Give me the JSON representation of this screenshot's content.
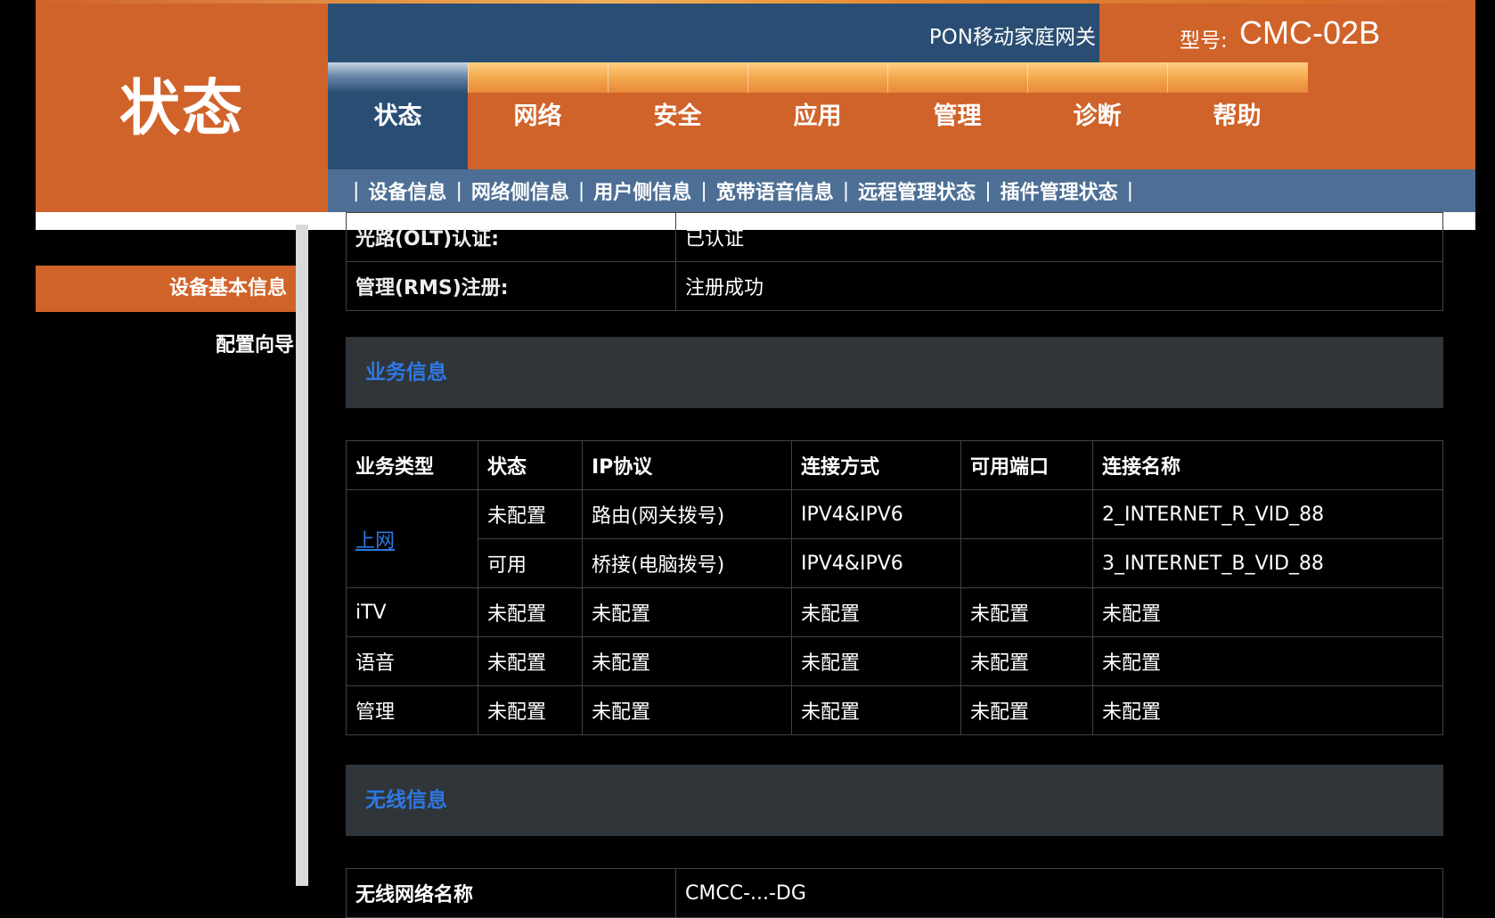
{
  "header": {
    "page_title": "状态",
    "product_name": "PON移动家庭网关",
    "model_label": "型号:",
    "model_value": "CMC-02B",
    "menu": [
      "状态",
      "网络",
      "安全",
      "应用",
      "管理",
      "诊断",
      "帮助"
    ],
    "active_menu": "状态",
    "submenu": [
      "设备信息",
      "网络侧信息",
      "用户侧信息",
      "宽带语音信息",
      "远程管理状态",
      "插件管理状态"
    ],
    "colors": {
      "orange": "#d0632a",
      "navy": "#2a4e73",
      "submenu_bg": "#4e6f95",
      "link_blue": "#2f78e4"
    }
  },
  "sidebar": {
    "items": [
      "设备基本信息",
      "配置向导"
    ],
    "active_item": "设备基本信息"
  },
  "top_table": {
    "rows": [
      {
        "label": "光路(OLT)认证:",
        "value": "已认证"
      },
      {
        "label": "管理(RMS)注册:",
        "value": "注册成功"
      }
    ]
  },
  "service_section": {
    "title": "业务信息",
    "headers": [
      "业务类型",
      "状态",
      "IP协议",
      "连接方式",
      "可用端口",
      "连接名称"
    ],
    "internet_label": "上网",
    "internet_rows": [
      {
        "status": "未配置",
        "protocol": "路由(网关拨号)",
        "mode": "IPV4&IPV6",
        "ports": "",
        "name": "2_INTERNET_R_VID_88"
      },
      {
        "status": "可用",
        "protocol": "桥接(电脑拨号)",
        "mode": "IPV4&IPV6",
        "ports": "",
        "name": "3_INTERNET_B_VID_88"
      }
    ],
    "other_rows": [
      {
        "type": "iTV",
        "status": "未配置",
        "protocol": "未配置",
        "mode": "未配置",
        "ports": "未配置",
        "name": "未配置"
      },
      {
        "type": "语音",
        "status": "未配置",
        "protocol": "未配置",
        "mode": "未配置",
        "ports": "未配置",
        "name": "未配置"
      },
      {
        "type": "管理",
        "status": "未配置",
        "protocol": "未配置",
        "mode": "未配置",
        "ports": "未配置",
        "name": "未配置"
      }
    ]
  },
  "wireless_section": {
    "title": "无线信息",
    "first_row": {
      "label": "无线网络名称",
      "value": "CMCC-...-DG"
    }
  }
}
